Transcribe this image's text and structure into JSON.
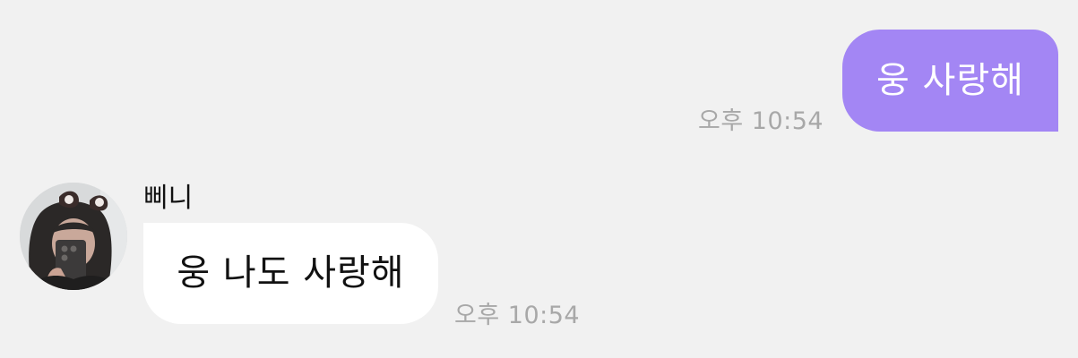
{
  "outgoing_message": {
    "text": "웅 사랑해",
    "time": "오후 10:54",
    "bubble_color": "#a386f4"
  },
  "incoming_message": {
    "sender": "삐니",
    "text": "웅 나도 사랑해",
    "time": "오후 10:54",
    "bubble_color": "#ffffff",
    "avatar": "profile-photo"
  },
  "background_color": "#f1f1f1"
}
